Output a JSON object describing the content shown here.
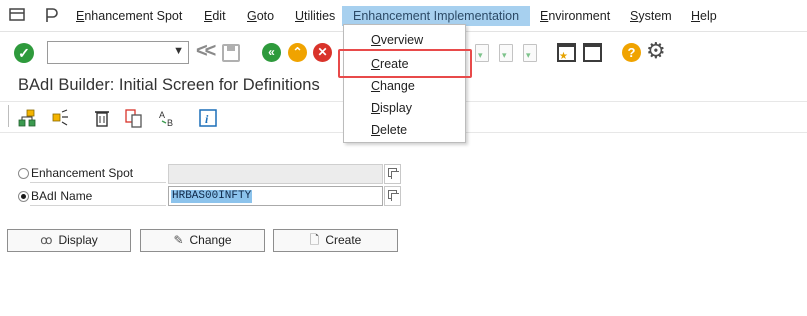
{
  "menubar": {
    "items": [
      {
        "mn": "E",
        "rest": "nhancement Spot"
      },
      {
        "mn": "E",
        "rest": "dit"
      },
      {
        "mn": "G",
        "rest": "oto"
      },
      {
        "mn": "U",
        "rest": "tilities"
      },
      {
        "mn": "E",
        "rest": "nhancement Implementation"
      },
      {
        "mn": "E",
        "rest": "nvironment"
      },
      {
        "mn": "S",
        "rest": "ystem"
      },
      {
        "mn": "H",
        "rest": "elp"
      }
    ],
    "active_index": 4
  },
  "dropdown": {
    "items": [
      {
        "mn": "O",
        "rest": "verview"
      },
      {
        "mn": "C",
        "rest": "reate"
      },
      {
        "mn": "C",
        "rest": "hange"
      },
      {
        "mn": "D",
        "rest": "isplay"
      },
      {
        "mn": "D",
        "rest": "elete"
      }
    ],
    "highlighted_index": 1,
    "highlight_color": "#e84a4a"
  },
  "toolbar": {
    "command_field_value": "",
    "icons": [
      "check-icon",
      "collapse-icon",
      "save-icon",
      "back-icon",
      "exit-icon",
      "cancel-icon",
      "doc-icon",
      "doc-upload-icon",
      "doc-download-icon",
      "layout-star-icon",
      "layout-icon",
      "help-icon",
      "gear-icon"
    ]
  },
  "page": {
    "title": "BAdI Builder: Initial Screen for Definitions"
  },
  "app_toolbar": {
    "icons": [
      "hierarchy-icon",
      "expand-icon",
      "delete-icon",
      "copy-icon",
      "rename-icon",
      "info-icon"
    ]
  },
  "form": {
    "enhancement_spot": {
      "label": "Enhancement Spot",
      "value": "",
      "selected": false
    },
    "badi_name": {
      "label": "BAdI Name",
      "value": "HRBAS00INFTY",
      "selected": true
    }
  },
  "buttons": {
    "display": "Display",
    "change": "Change",
    "create": "Create"
  },
  "colors": {
    "menu_active_bg": "#a7d0ef",
    "ok_green": "#2e9a3c",
    "selection_blue": "#8cc3ec"
  }
}
